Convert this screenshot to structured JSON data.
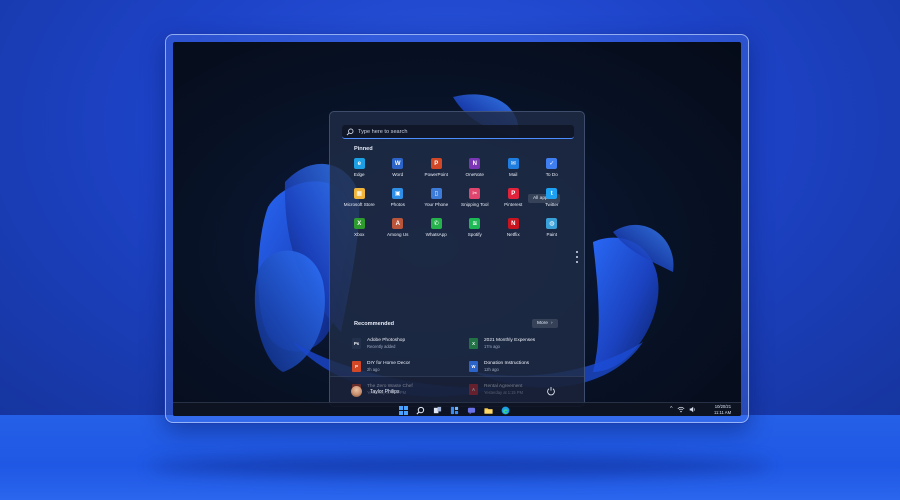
{
  "search": {
    "placeholder": "Type here to search"
  },
  "pinned": {
    "title": "Pinned",
    "all_apps_label": "All apps",
    "apps": [
      {
        "label": "Edge",
        "icon": "edge-icon",
        "color": "#1d9fe3",
        "glyph": "e"
      },
      {
        "label": "Word",
        "icon": "word-icon",
        "color": "#2b63c8",
        "glyph": "W"
      },
      {
        "label": "PowerPoint",
        "icon": "powerpoint-icon",
        "color": "#d24726",
        "glyph": "P"
      },
      {
        "label": "OneNote",
        "icon": "onenote-icon",
        "color": "#7a36b5",
        "glyph": "N"
      },
      {
        "label": "Mail",
        "icon": "mail-icon",
        "color": "#1f7de0",
        "glyph": "✉"
      },
      {
        "label": "To Do",
        "icon": "todo-icon",
        "color": "#3f7ef0",
        "glyph": "✓"
      },
      {
        "label": "Microsoft Store",
        "icon": "store-icon",
        "color": "#f0b43a",
        "glyph": "▦"
      },
      {
        "label": "Photos",
        "icon": "photos-icon",
        "color": "#2f8fe6",
        "glyph": "▣"
      },
      {
        "label": "Your Phone",
        "icon": "phone-icon",
        "color": "#3d7bd9",
        "glyph": "▯"
      },
      {
        "label": "Snipping Tool",
        "icon": "snipping-tool-icon",
        "color": "#e0466d",
        "glyph": "✂"
      },
      {
        "label": "Pinterest",
        "icon": "pinterest-icon",
        "color": "#e0233b",
        "glyph": "P"
      },
      {
        "label": "Twitter",
        "icon": "twitter-icon",
        "color": "#1da1f2",
        "glyph": "t"
      },
      {
        "label": "Xbox",
        "icon": "xbox-icon",
        "color": "#2e9b2e",
        "glyph": "X"
      },
      {
        "label": "Among Us",
        "icon": "among-us-icon",
        "color": "#b8553a",
        "glyph": "A"
      },
      {
        "label": "WhatsApp",
        "icon": "whatsapp-icon",
        "color": "#25b24a",
        "glyph": "✆"
      },
      {
        "label": "Spotify",
        "icon": "spotify-icon",
        "color": "#1db954",
        "glyph": "≋"
      },
      {
        "label": "Netflix",
        "icon": "netflix-icon",
        "color": "#c8141f",
        "glyph": "N"
      },
      {
        "label": "Paint",
        "icon": "paint-icon",
        "color": "#3aa0d8",
        "glyph": "◍"
      }
    ]
  },
  "recommended": {
    "title": "Recommended",
    "more_label": "More",
    "items": [
      {
        "name": "Adobe Photoshop",
        "time": "Recently added",
        "icon": "photoshop-icon",
        "color": "#23314d",
        "glyph": "Ps"
      },
      {
        "name": "2021 Monthly Expenses",
        "time": "17m ago",
        "icon": "excel-file-icon",
        "color": "#217346",
        "glyph": "X"
      },
      {
        "name": "DIY for Home Decor",
        "time": "2h ago",
        "icon": "pdf-file-icon",
        "color": "#d24726",
        "glyph": "P"
      },
      {
        "name": "Donation Instructions",
        "time": "12h ago",
        "icon": "word-file-icon",
        "color": "#2b63c8",
        "glyph": "W"
      },
      {
        "name": "The Zero Waste Chef",
        "time": "Yesterday at 4:24 PM",
        "icon": "powerpoint-file-icon",
        "color": "#d24726",
        "glyph": "P"
      },
      {
        "name": "Rental Agreement",
        "time": "Yesterday at 1:15 PM",
        "icon": "pdf-file-icon",
        "color": "#c8262c",
        "glyph": "A"
      }
    ]
  },
  "user": {
    "name": "Taylor Philips"
  },
  "taskbar": {
    "apps": [
      "windows-start-icon",
      "search-icon",
      "task-view-icon",
      "widgets-icon",
      "chat-icon",
      "file-explorer-icon",
      "edge-icon"
    ],
    "tray": {
      "chevron": "^",
      "wifi": "wifi-icon",
      "volume": "volume-icon"
    },
    "clock": {
      "date": "10/20/21",
      "time": "11:11 AM"
    }
  },
  "colors": {
    "accent": "#4c8dff",
    "wallpaper_bloom": "#1f4fd8",
    "room": "#1d43c8"
  }
}
